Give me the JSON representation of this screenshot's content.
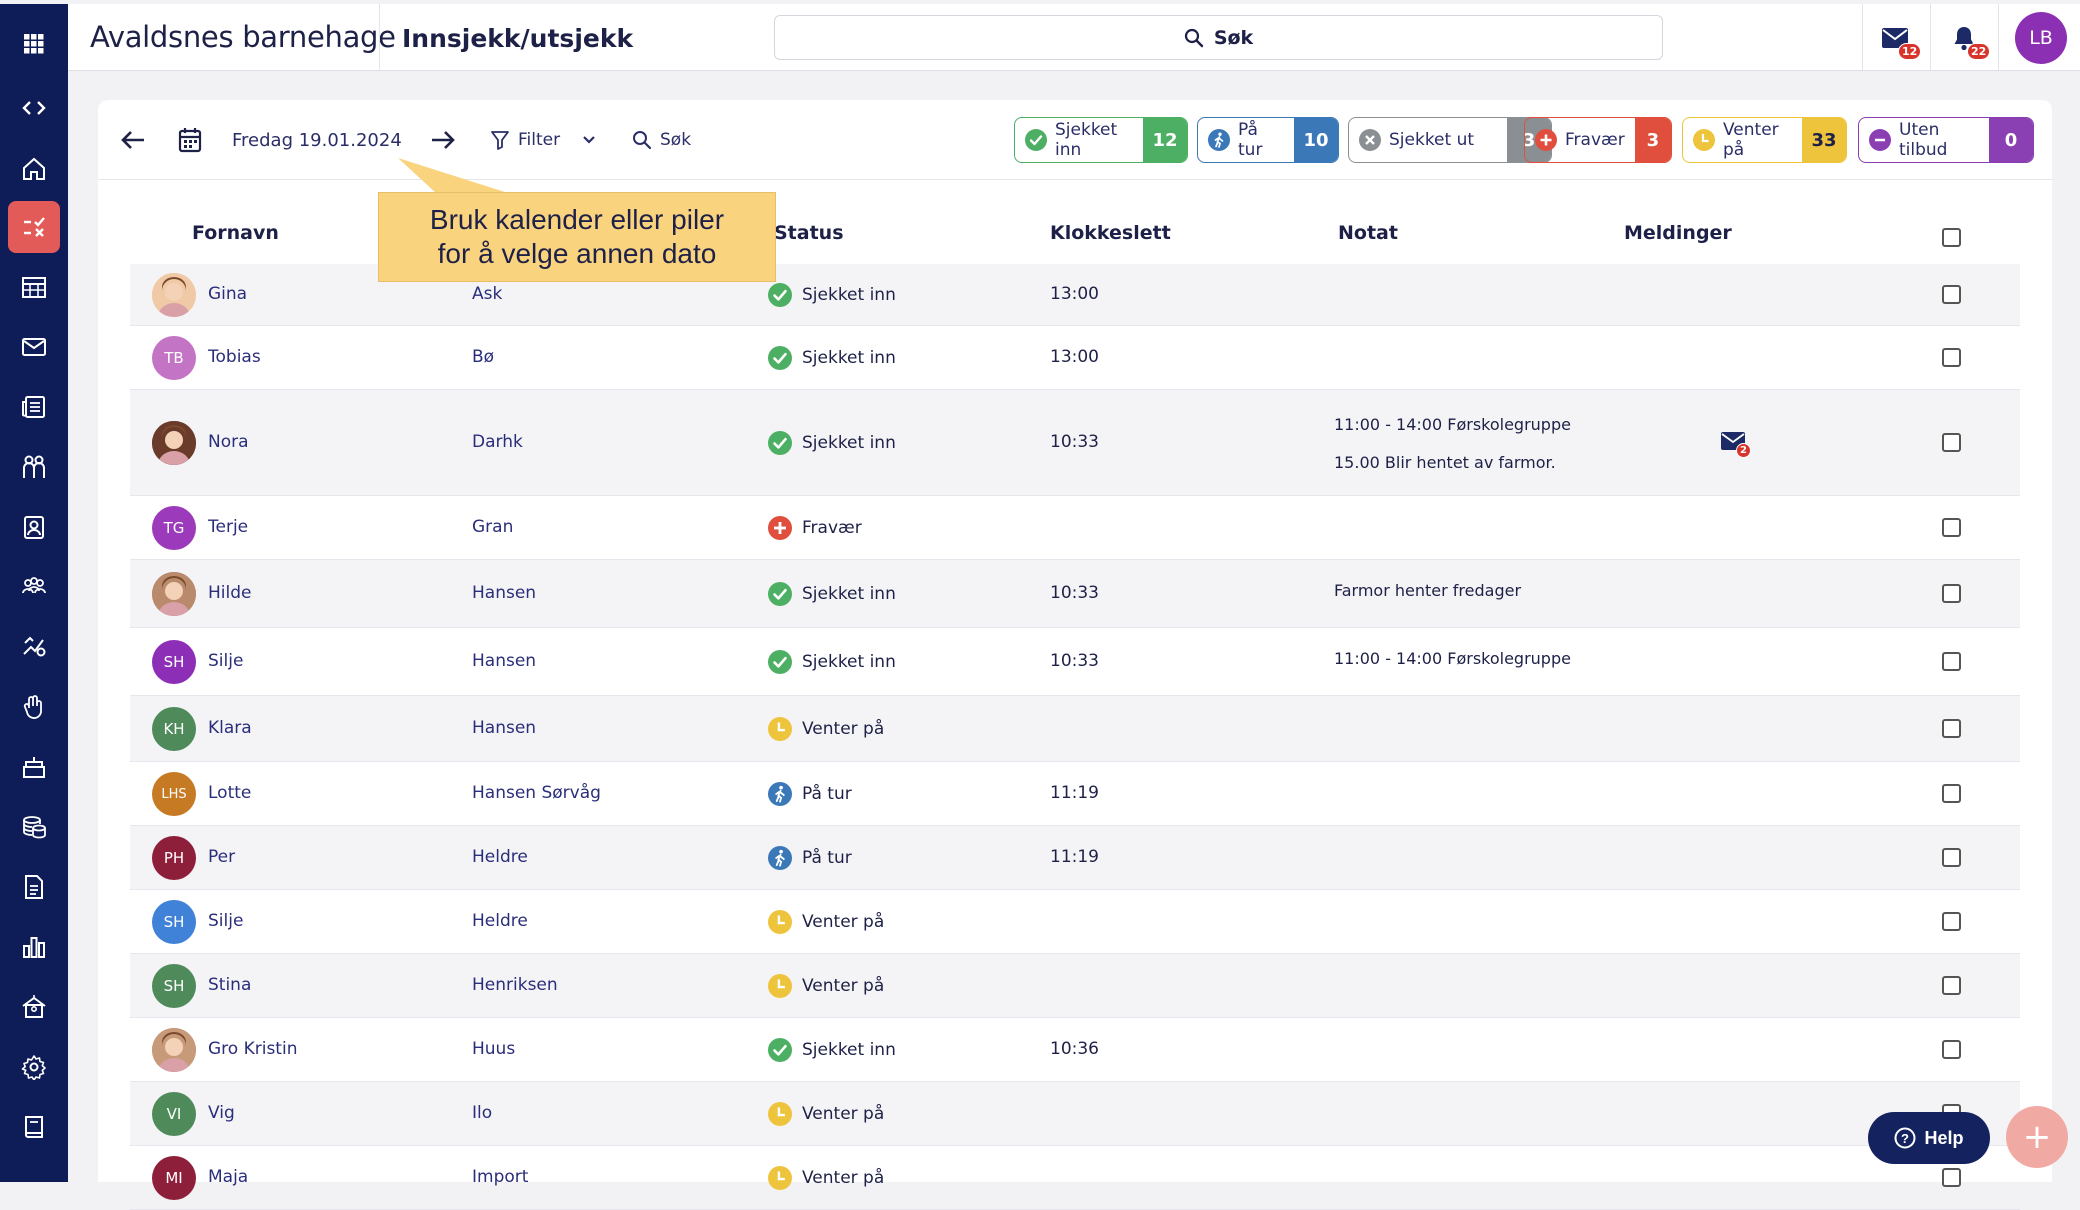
{
  "app": {
    "org_name": "Avaldsnes barnehage",
    "page_title": "Innsjekk/utsjekk"
  },
  "global_search": {
    "label": "Søk"
  },
  "topbar": {
    "mail_badge": "12",
    "bell_badge": "22",
    "user_initials": "LB"
  },
  "sidebar": {
    "items": [
      "apps-icon",
      "expand-collapse-icon",
      "home-icon",
      "checkin-icon",
      "calendar-grid-icon",
      "mail-icon",
      "news-icon",
      "children-icon",
      "contacts-icon",
      "groups-icon",
      "activities-icon",
      "hand-icon",
      "birthday-icon",
      "finance-icon",
      "documents-icon",
      "reports-icon",
      "kindergarten-icon",
      "settings-icon",
      "handbook-icon"
    ],
    "active_index": 3
  },
  "toolbar": {
    "date_label": "Fredag 19.01.2024",
    "filter_label": "Filter",
    "search_label": "Søk"
  },
  "status_pills": [
    {
      "label": "Sjekket inn",
      "count": "12",
      "color": "#4caf63",
      "icon": "check-circle-icon"
    },
    {
      "label": "På tur",
      "count": "10",
      "color": "#3b78b8",
      "icon": "walking-icon"
    },
    {
      "label": "Sjekket ut",
      "count": "3",
      "color": "#8a8f93",
      "icon": "x-circle-icon"
    },
    {
      "label": "Fravær",
      "count": "3",
      "color": "#e04e3e",
      "icon": "plus-circle-icon"
    },
    {
      "label": "Venter på",
      "count": "33",
      "color": "#eec43c",
      "icon": "clock-icon"
    },
    {
      "label": "Uten tilbud",
      "count": "0",
      "color": "#8a3fb3",
      "icon": "minus-circle-icon"
    }
  ],
  "tooltip": {
    "line1": "Bruk kalender eller piler",
    "line2": "for å velge annen dato"
  },
  "table": {
    "headers": {
      "first_name": "Fornavn",
      "status": "Status",
      "time": "Klokkeslett",
      "note": "Notat",
      "messages": "Meldinger"
    },
    "rows": [
      {
        "first": "Gina",
        "last": "Ask",
        "initials": "",
        "avatar_color": "#f0c9a6",
        "photo": true,
        "status": "Sjekket inn",
        "status_icon": "check",
        "time": "13:00",
        "notes": [],
        "messages": ""
      },
      {
        "first": "Tobias",
        "last": "Bø",
        "initials": "TB",
        "avatar_color": "#c374c4",
        "photo": false,
        "status": "Sjekket inn",
        "status_icon": "check",
        "time": "13:00",
        "notes": [],
        "messages": ""
      },
      {
        "first": "Nora",
        "last": "Darhk",
        "initials": "",
        "avatar_color": "#6a3b2a",
        "photo": true,
        "status": "Sjekket inn",
        "status_icon": "check",
        "time": "10:33",
        "notes": [
          "11:00 - 14:00 Førskolegruppe",
          "15.00 Blir hentet av farmor."
        ],
        "messages": "2"
      },
      {
        "first": "Terje",
        "last": "Gran",
        "initials": "TG",
        "avatar_color": "#9b3bbb",
        "photo": false,
        "status": "Fravær",
        "status_icon": "plus",
        "time": "",
        "notes": [],
        "messages": ""
      },
      {
        "first": "Hilde",
        "last": "Hansen",
        "initials": "",
        "avatar_color": "#b98a6c",
        "photo": true,
        "status": "Sjekket inn",
        "status_icon": "check",
        "time": "10:33",
        "notes": [
          "Farmor henter fredager"
        ],
        "messages": ""
      },
      {
        "first": "Silje",
        "last": "Hansen",
        "initials": "SH",
        "avatar_color": "#8d2fb6",
        "photo": false,
        "status": "Sjekket inn",
        "status_icon": "check",
        "time": "10:33",
        "notes": [
          "11:00 - 14:00 Førskolegruppe"
        ],
        "messages": ""
      },
      {
        "first": "Klara",
        "last": "Hansen",
        "initials": "KH",
        "avatar_color": "#4f8a5a",
        "photo": false,
        "status": "Venter på",
        "status_icon": "clock",
        "time": "",
        "notes": [],
        "messages": ""
      },
      {
        "first": "Lotte",
        "last": "Hansen Sørvåg",
        "initials": "LHS",
        "avatar_color": "#c77a24",
        "photo": false,
        "status": "På tur",
        "status_icon": "walk",
        "time": "11:19",
        "notes": [],
        "messages": ""
      },
      {
        "first": "Per",
        "last": "Heldre",
        "initials": "PH",
        "avatar_color": "#8e1f3b",
        "photo": false,
        "status": "På tur",
        "status_icon": "walk",
        "time": "11:19",
        "notes": [],
        "messages": ""
      },
      {
        "first": "Silje",
        "last": "Heldre",
        "initials": "SH",
        "avatar_color": "#3f82d8",
        "photo": false,
        "status": "Venter på",
        "status_icon": "clock",
        "time": "",
        "notes": [],
        "messages": ""
      },
      {
        "first": "Stina",
        "last": "Henriksen",
        "initials": "SH",
        "avatar_color": "#4f8a5a",
        "photo": false,
        "status": "Venter på",
        "status_icon": "clock",
        "time": "",
        "notes": [],
        "messages": ""
      },
      {
        "first": "Gro Kristin",
        "last": "Huus",
        "initials": "",
        "avatar_color": "#c79a7a",
        "photo": true,
        "status": "Sjekket inn",
        "status_icon": "check",
        "time": "10:36",
        "notes": [],
        "messages": ""
      },
      {
        "first": "Vig",
        "last": "Ilo",
        "initials": "VI",
        "avatar_color": "#4f8a5a",
        "photo": false,
        "status": "Venter på",
        "status_icon": "clock",
        "time": "",
        "notes": [],
        "messages": ""
      },
      {
        "first": "Maja",
        "last": "Import",
        "initials": "MI",
        "avatar_color": "#8e1f3b",
        "photo": false,
        "status": "Venter på",
        "status_icon": "clock",
        "time": "",
        "notes": [],
        "messages": ""
      }
    ]
  },
  "help": {
    "label": "Help"
  },
  "fab": {
    "label": "+"
  }
}
